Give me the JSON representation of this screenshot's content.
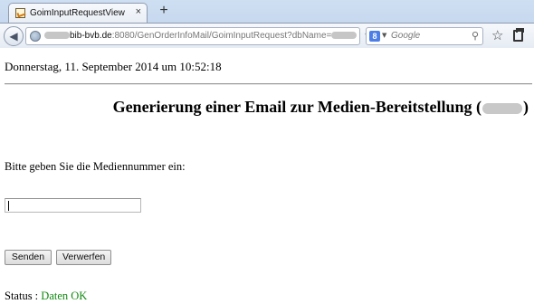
{
  "browser": {
    "tab_title": "GoimInputRequestView",
    "tab_close": "×",
    "new_tab": "+",
    "url_host": "bib-bvb.de",
    "url_path": ":8080/GenOrderInfoMail/GoimInputRequest?dbName=",
    "search_placeholder": "Google",
    "search_engine_icon": "google-icon"
  },
  "page": {
    "datetime": "Donnerstag, 11. September 2014 um 10:52:18",
    "heading_prefix": "Generierung einer Email zur Medien-Bereitstellung (",
    "heading_suffix": ")",
    "prompt": "Bitte geben Sie die Mediennummer ein:",
    "media_input_value": "",
    "send_label": "Senden",
    "reset_label": "Verwerfen",
    "status_label": "Status :",
    "status_value": "Daten OK",
    "status_color": "#118a11"
  }
}
